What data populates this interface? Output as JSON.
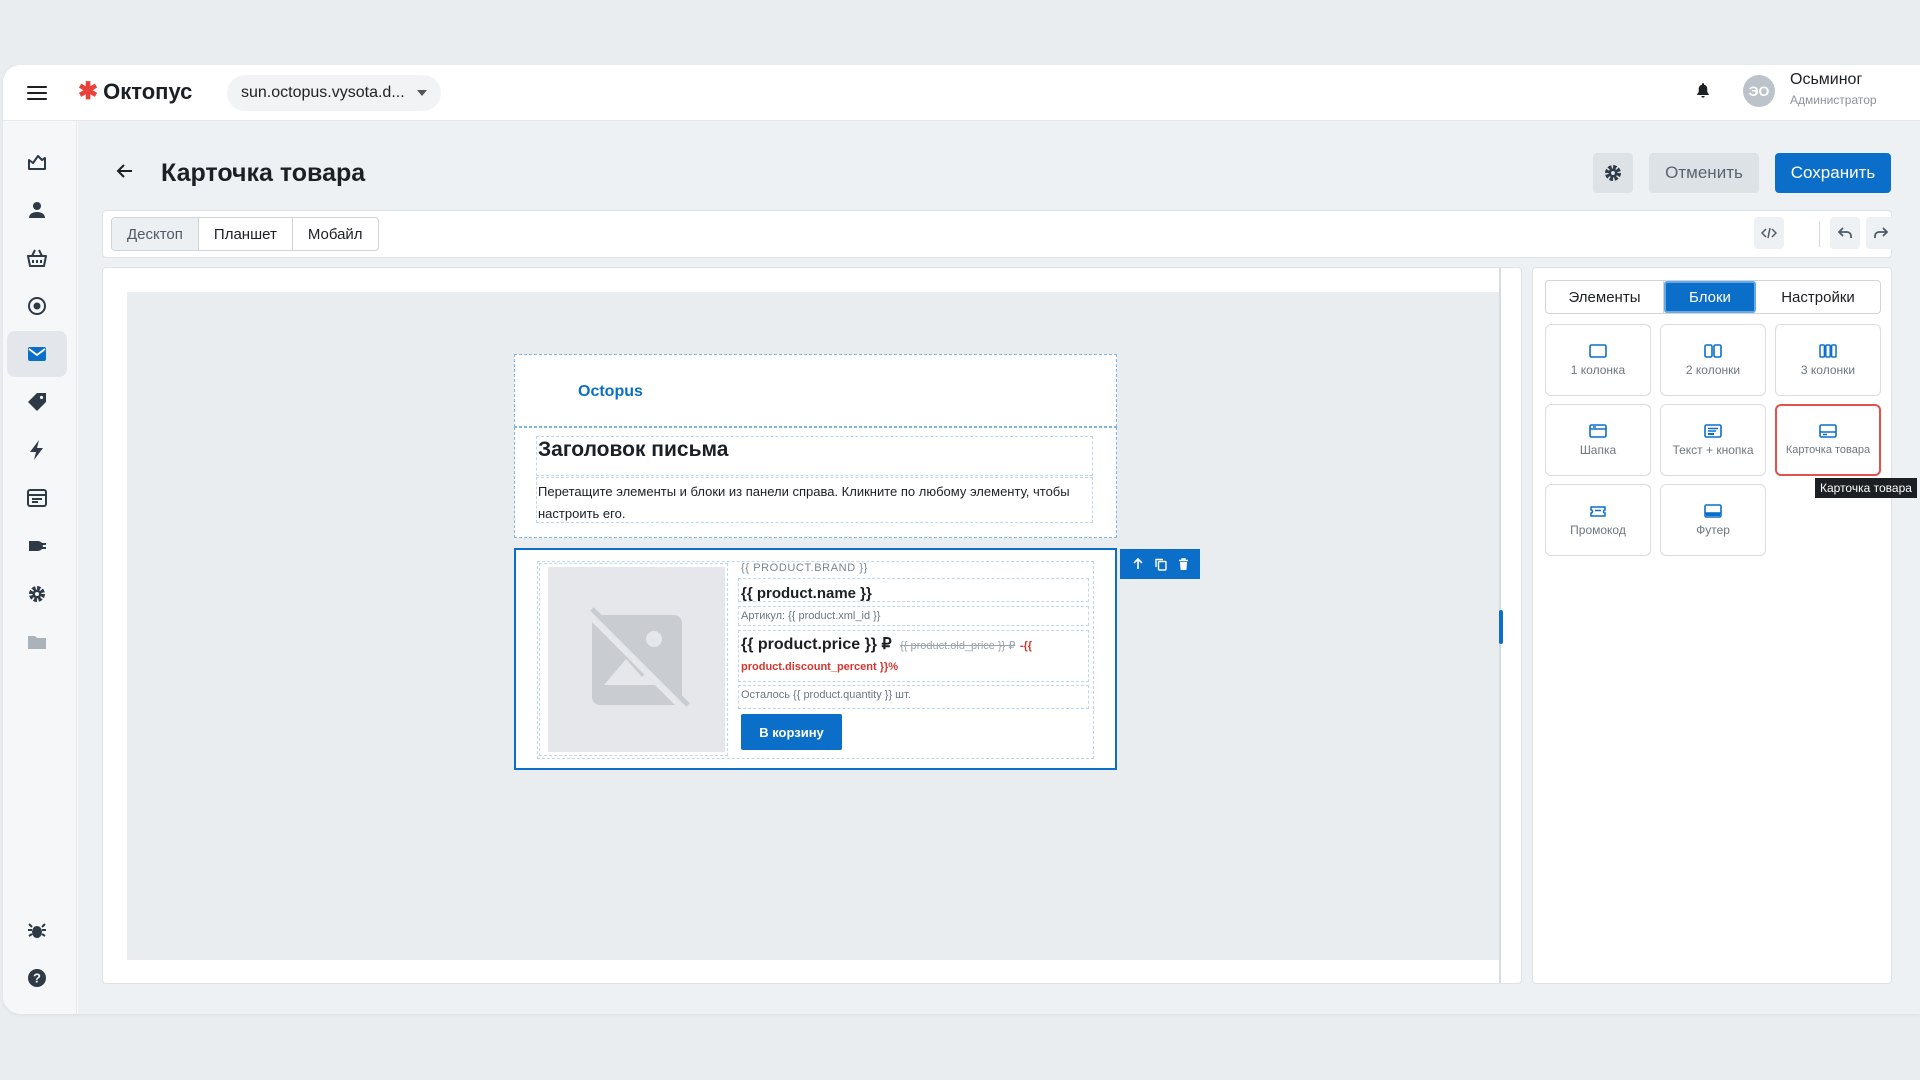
{
  "app": {
    "logo_text": "Октопус",
    "domain": "sun.octopus.vysota.d...",
    "user_name": "Осьминог",
    "user_role": "Администратор",
    "user_initials": "ЭО"
  },
  "sidebar": {
    "items": [
      {
        "name": "dashboard-icon",
        "active": false
      },
      {
        "name": "user-icon",
        "active": false
      },
      {
        "name": "basket-icon",
        "active": false
      },
      {
        "name": "target-icon",
        "active": false
      },
      {
        "name": "mail-icon",
        "active": true
      },
      {
        "name": "tag-icon",
        "active": false
      },
      {
        "name": "lightning-icon",
        "active": false
      },
      {
        "name": "browser-icon",
        "active": false
      },
      {
        "name": "plug-icon",
        "active": false
      },
      {
        "name": "gear-icon",
        "active": false
      },
      {
        "name": "folder-icon",
        "active": false
      },
      {
        "name": "bug-icon",
        "active": false
      },
      {
        "name": "help-icon",
        "active": false
      }
    ]
  },
  "header": {
    "title": "Карточка товара",
    "cancel_label": "Отменить",
    "save_label": "Сохранить"
  },
  "toolbar": {
    "devices": [
      "Десктоп",
      "Планшет",
      "Мобайл"
    ],
    "active_device": "Десктоп"
  },
  "email": {
    "logo_text": "Octopus",
    "heading": "Заголовок письма",
    "paragraph": "Перетащите элементы и блоки из панели справа. Кликните по любому элементу, чтобы настроить его.",
    "product": {
      "brand": "{{ PRODUCT.BRAND }}",
      "name": "{{ product.name }}",
      "sku": "Артикул: {{ product.xml_id }}",
      "price": "{{ product.price }} ₽",
      "old_price": "{{ product.old_price }} ₽",
      "discount": " -{{ product.discount_percent }}%",
      "quantity": "Осталось {{ product.quantity }} шт.",
      "cart_button": "В корзину"
    }
  },
  "right_panel": {
    "tabs": [
      "Элементы",
      "Блоки",
      "Настройки"
    ],
    "active_tab": "Блоки",
    "blocks": [
      {
        "label": "1 колонка",
        "icon": "one-column-icon"
      },
      {
        "label": "2 колонки",
        "icon": "two-columns-icon"
      },
      {
        "label": "3 колонки",
        "icon": "three-columns-icon"
      },
      {
        "label": "Шапка",
        "icon": "header-block-icon"
      },
      {
        "label": "Текст + кнопка",
        "icon": "text-button-icon"
      },
      {
        "label": "Карточка товара",
        "icon": "product-card-icon",
        "highlighted": true
      },
      {
        "label": "Промокод",
        "icon": "promo-code-icon"
      },
      {
        "label": "Футер",
        "icon": "footer-block-icon"
      }
    ],
    "tooltip": "Карточка товара"
  },
  "colors": {
    "accent": "#0b6fc9",
    "highlight": "#e0524b",
    "logo_mark": "#e8423a",
    "discount": "#d9362e"
  }
}
